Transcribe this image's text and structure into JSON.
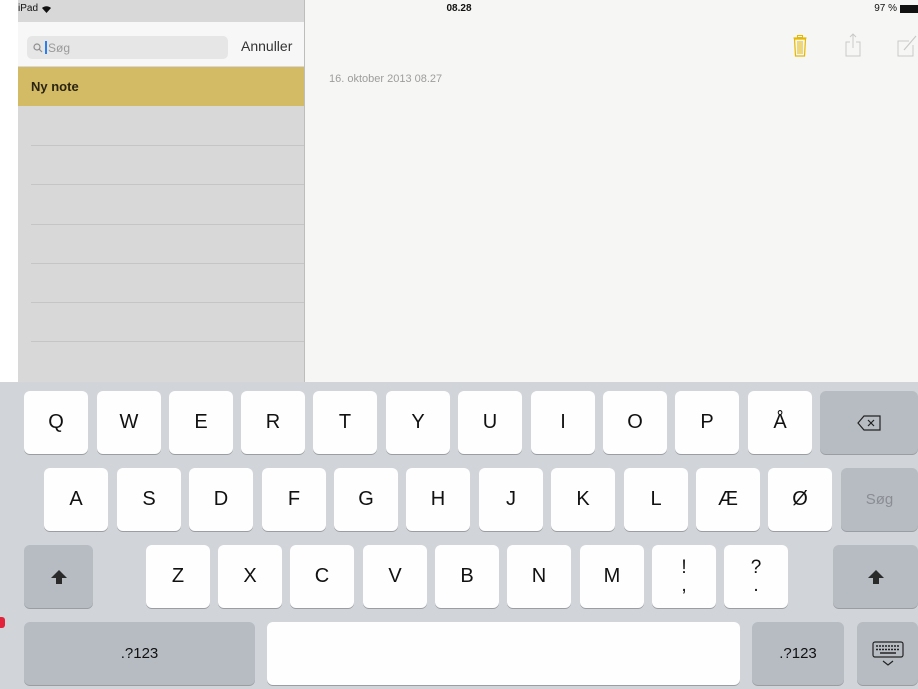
{
  "status_bar": {
    "device": "iPad",
    "time": "08.28",
    "battery": "97 %"
  },
  "sidebar": {
    "search_placeholder": "Søg",
    "cancel_label": "Annuller",
    "notes": [
      {
        "title": "Ny note"
      }
    ]
  },
  "note": {
    "date": "16. oktober 2013 08.27"
  },
  "toolbar": {
    "icons": [
      "trash-icon",
      "share-icon",
      "compose-icon"
    ],
    "trash_color": "#e6b800"
  },
  "keyboard": {
    "row1": [
      "Q",
      "W",
      "E",
      "R",
      "T",
      "Y",
      "U",
      "I",
      "O",
      "P",
      "Å"
    ],
    "row2": [
      "A",
      "S",
      "D",
      "F",
      "G",
      "H",
      "J",
      "K",
      "L",
      "Æ",
      "Ø"
    ],
    "row3": [
      "Z",
      "X",
      "C",
      "V",
      "B",
      "N",
      "M"
    ],
    "row3_punct": [
      {
        "top": "!",
        "bottom": ","
      },
      {
        "top": "?",
        "bottom": "."
      }
    ],
    "search_key": "Søg",
    "numbers_key": ".?123"
  }
}
